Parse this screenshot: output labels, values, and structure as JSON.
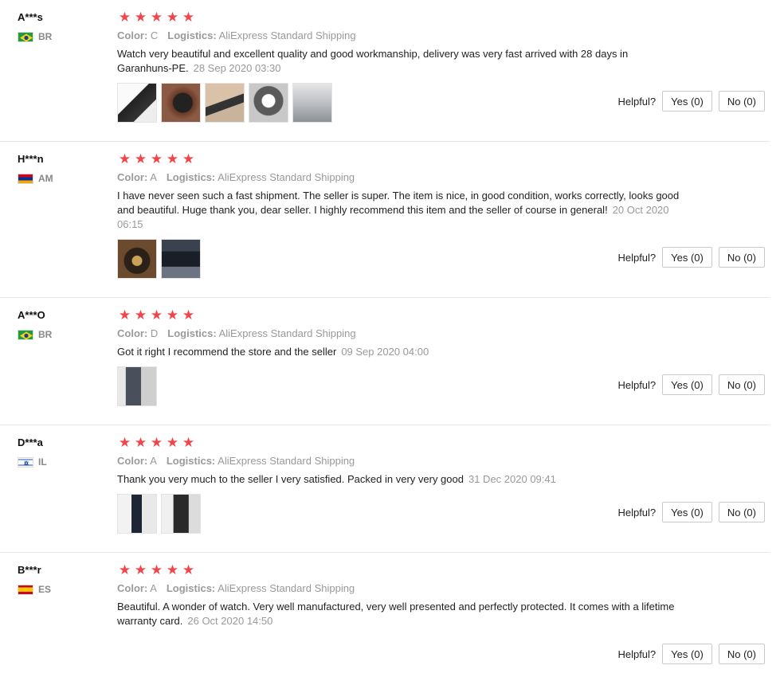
{
  "labels": {
    "color": "Color:",
    "logistics": "Logistics:",
    "helpful": "Helpful?"
  },
  "colors": {
    "star": "#f2444b",
    "meta": "#999999",
    "border": "#e6e6e6"
  },
  "reviews": [
    {
      "user": "A***s",
      "country": "BR",
      "flag": "brazil-flag-icon",
      "rating": 5,
      "color_value": "C",
      "logistics_value": "AliExpress Standard Shipping",
      "text": "Watch very beautiful and excellent quality and good workmanship, delivery was very fast arrived with 28 days in Garanhuns-PE.",
      "date": "28 Sep 2020 03:30",
      "photos": [
        "photo-1",
        "photo-2",
        "photo-3",
        "photo-4",
        "photo-5"
      ],
      "yes": "Yes (0)",
      "no": "No (0)"
    },
    {
      "user": "H***n",
      "country": "AM",
      "flag": "armenia-flag-icon",
      "rating": 5,
      "color_value": "A",
      "logistics_value": "AliExpress Standard Shipping",
      "text": "I have never seen such a fast shipment. The seller is super. The item is nice, in good condition, works correctly, looks good and beautiful. Huge thank you, dear seller. I highly recommend this item and the seller of course in general!",
      "date": "20 Oct 2020 06:15",
      "photos": [
        "photo-1",
        "photo-2"
      ],
      "yes": "Yes (0)",
      "no": "No (0)"
    },
    {
      "user": "A***O",
      "country": "BR",
      "flag": "brazil-flag-icon",
      "rating": 5,
      "color_value": "D",
      "logistics_value": "AliExpress Standard Shipping",
      "text": "Got it right I recommend the store and the seller",
      "date": "09 Sep 2020 04:00",
      "photos": [
        "photo-1"
      ],
      "yes": "Yes (0)",
      "no": "No (0)"
    },
    {
      "user": "D***a",
      "country": "IL",
      "flag": "israel-flag-icon",
      "rating": 5,
      "color_value": "A",
      "logistics_value": "AliExpress Standard Shipping",
      "text": "Thank you very much to the seller I very satisfied. Packed in very very good",
      "date": "31 Dec 2020 09:41",
      "photos": [
        "photo-1",
        "photo-2"
      ],
      "yes": "Yes (0)",
      "no": "No (0)"
    },
    {
      "user": "B***r",
      "country": "ES",
      "flag": "spain-flag-icon",
      "rating": 5,
      "color_value": "A",
      "logistics_value": "AliExpress Standard Shipping",
      "text": "Beautiful. A wonder of watch. Very well manufactured, very well presented and perfectly protected. It comes with a lifetime warranty card.",
      "date": "26 Oct 2020 14:50",
      "photos": [],
      "yes": "Yes (0)",
      "no": "No (0)"
    }
  ]
}
